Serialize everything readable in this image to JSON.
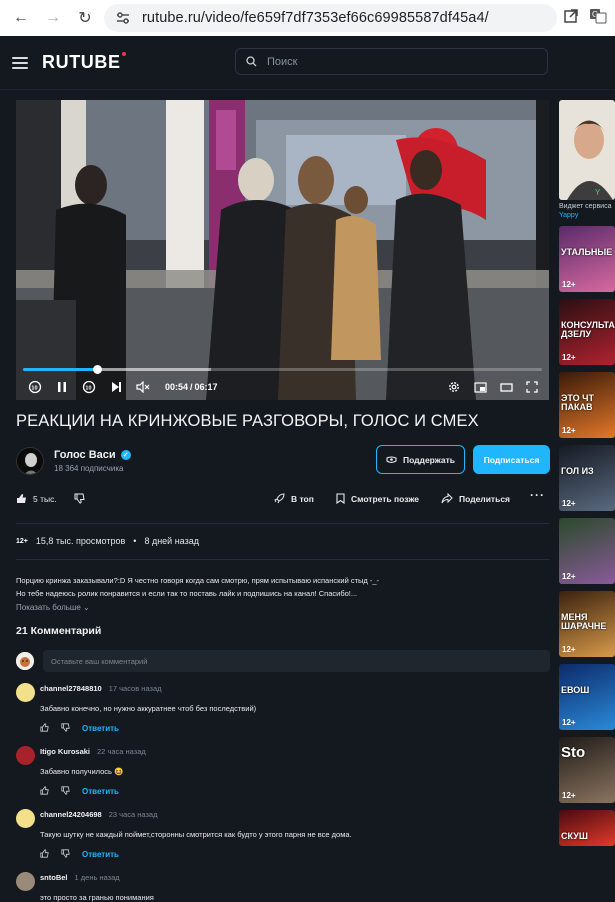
{
  "browser": {
    "url": "rutube.ru/video/fe659f7df7353ef66c69985587df45a4/"
  },
  "site": {
    "logo": "RUTUBE",
    "search_placeholder": "Поиск"
  },
  "player": {
    "time_current": "00:54",
    "time_total": "06:17",
    "progress_fraction": 0.143,
    "skip_back_label": "10",
    "skip_forward_label": "10"
  },
  "video": {
    "title": "РЕАКЦИИ НА КРИНЖОВЫЕ РАЗГОВОРЫ, ГОЛОС И СМЕХ",
    "views": "15,8 тыс. просмотров",
    "age": "8 дней назад",
    "age_rating": "12+"
  },
  "channel": {
    "name": "Голос Васи",
    "subscribers": "18 364 подписчика",
    "support_label": "Поддержать",
    "subscribe_label": "Подписаться"
  },
  "actions": {
    "likes": "5 тыс.",
    "top_label": "В топ",
    "watch_later_label": "Смотреть позже",
    "share_label": "Поделиться"
  },
  "description": {
    "line1": "Порцию кринжа заказывали?:D Я честно говоря когда сам смотрю, прям испытываю испанский стыд -_-",
    "line2": "Но тебе надеюсь ролик понравится и если так то поставь лайк и подпишись на канал! Спасибо!...",
    "show_more": "Показать больше"
  },
  "comments": {
    "title": "21 Комментарий",
    "input_placeholder": "Оставьте ваш комментарий",
    "reply_label": "Ответить",
    "items": [
      {
        "author": "channel27848810",
        "time": "17 часов назад",
        "text": "Забавно конечно, но нужно аккуратнее чтоб без последствий)"
      },
      {
        "author": "Itigo Kurosaki",
        "time": "22 часа назад",
        "text": "Забавно получилось 😆"
      },
      {
        "author": "channel24204698",
        "time": "23 часа назад",
        "text": "Такую шутку не каждый поймет,сторонны смотрится как будто у этого парня не все дома."
      },
      {
        "author": "sntoBel",
        "time": "1 день назад",
        "text": "это просто за гранью понимания"
      }
    ]
  },
  "sidebar": {
    "first_title": "Виджет сервиса",
    "first_channel": "Yappy",
    "captions": [
      "УТАЛЬНЫЕ",
      "КОНСУЛЬТАН ДЗЕЛУ",
      "ЭТО ЧТ ПАКАВ",
      "ГОЛ ИЗ",
      "",
      "МЕНЯ ШАРАЧНЕ",
      "ЕВОШ",
      "Sto",
      "СКУШ"
    ],
    "age_badges": [
      "12+",
      "12+",
      "12+",
      "12+",
      "12+",
      "12+",
      "12+",
      "12+"
    ]
  },
  "colors": {
    "accent": "#1fb5ff",
    "background": "#14191f",
    "brand_dot": "#f2324a"
  }
}
